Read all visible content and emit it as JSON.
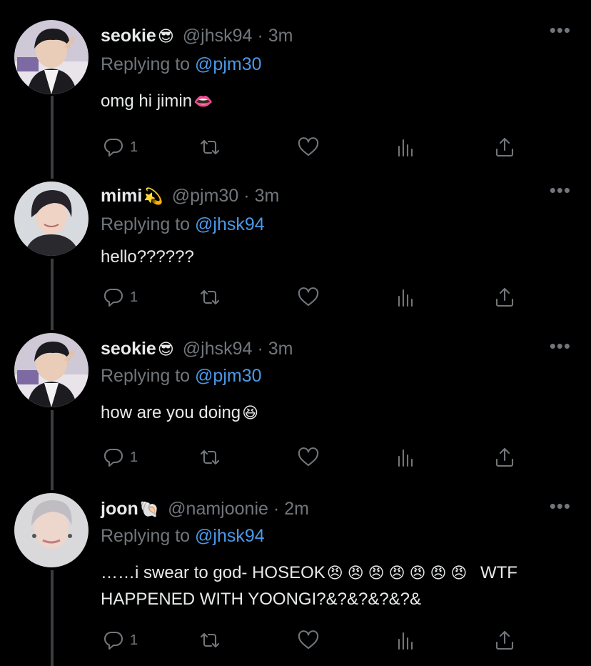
{
  "tweets": [
    {
      "name": "seokie",
      "name_emoji": "😎",
      "handle": "@jhsk94",
      "time": "3m",
      "replying_prefix": "Replying to",
      "replying_to": "@pjm30",
      "text": "omg hi jimin",
      "text_emoji": "👄",
      "reply_count": "1",
      "avatar": "avatar-seokie"
    },
    {
      "name": "mimi",
      "name_emoji": "💫",
      "handle": "@pjm30",
      "time": "3m",
      "replying_prefix": "Replying to",
      "replying_to": "@jhsk94",
      "text": "hello??????",
      "text_emoji": "",
      "reply_count": "1",
      "avatar": "avatar-mimi"
    },
    {
      "name": "seokie",
      "name_emoji": "😎",
      "handle": "@jhsk94",
      "time": "3m",
      "replying_prefix": "Replying to",
      "replying_to": "@pjm30",
      "text": "how are you doing",
      "text_emoji": "😆",
      "reply_count": "1",
      "avatar": "avatar-seokie"
    },
    {
      "name": "joon",
      "name_emoji": "🐚",
      "handle": "@namjoonie",
      "time": "2m",
      "replying_prefix": "Replying to",
      "replying_to": "@jhsk94",
      "text": "……i swear to god- HOSEOK",
      "text_emoji": "😠😠😠😠😠😠😠",
      "text_after": "WTF HAPPENED WITH YOONGI?&?&?&?&?&",
      "reply_count": "1",
      "avatar": "avatar-joon"
    }
  ],
  "colors": {
    "background": "#000000",
    "text_primary": "#e7e9ea",
    "text_secondary": "#71767b",
    "link": "#4a99e9",
    "thread_line": "#3a3d41"
  },
  "icons": [
    "reply-icon",
    "retweet-icon",
    "like-icon",
    "stats-icon",
    "share-icon",
    "more-icon"
  ]
}
